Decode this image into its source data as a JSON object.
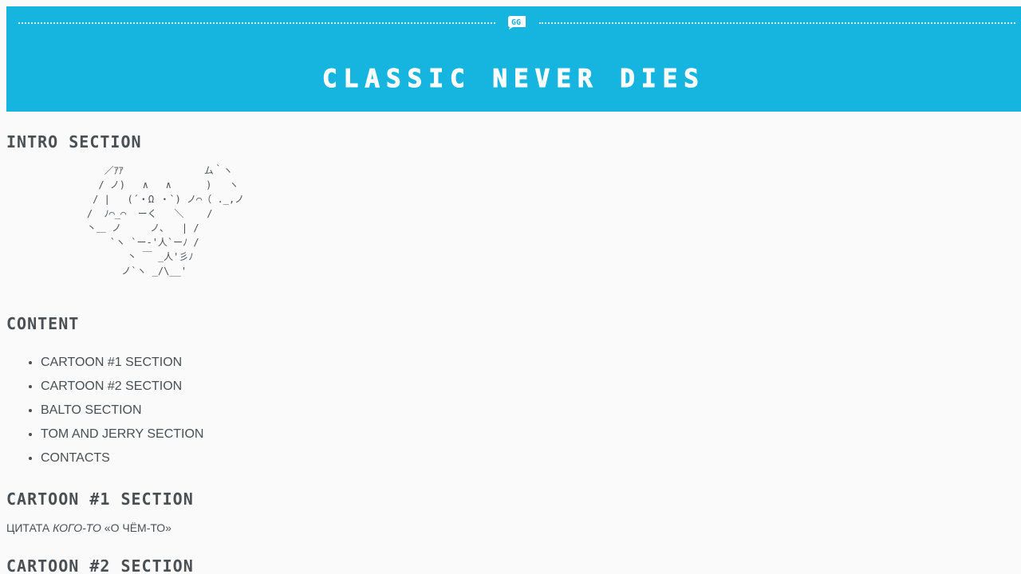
{
  "banner": {
    "title": "CLASSIC NEVER DIES",
    "icon": "quote-icon",
    "background_color": "#15b5e0"
  },
  "intro": {
    "heading": "INTRO SECTION",
    "ascii_art": "       ／ｱｱ              ム｀ヽ\n      / ノ)   ∧   ∧      )   ヽ\n     / |   (´・Ω ・`) ノ⌒（ ._,ノ\n    /  ﾉ⌒_⌒  ーく   ＼    /\n    丶＿ ノ     ノ､   | /\n        `ヽ `ー-'人`ーﾉ /\n           丶 ￣ _人'彡ﾉ\n          ノ`ヽ _/\\__'"
  },
  "content": {
    "heading": "CONTENT",
    "items": [
      {
        "label": "CARTOON #1 SECTION"
      },
      {
        "label": "CARTOON #2 SECTION"
      },
      {
        "label": "BALTO SECTION"
      },
      {
        "label": "TOM AND JERRY SECTION"
      },
      {
        "label": "CONTACTS"
      }
    ]
  },
  "cartoon1": {
    "heading": "CARTOON #1 SECTION",
    "quote_prefix": "ЦИТАТА ",
    "quote_author": "КОГО-ТО",
    "quote_text": " «О ЧЁМ-ТО»"
  },
  "cartoon2": {
    "heading": "CARTOON #2 SECTION"
  }
}
